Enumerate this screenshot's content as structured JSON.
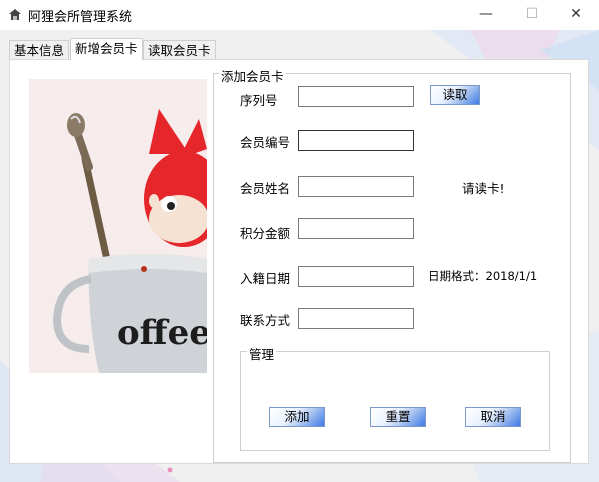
{
  "window": {
    "title": "阿狸会所管理系统",
    "minimize": "—",
    "maximize": "☐",
    "close": "✕"
  },
  "tabs": [
    {
      "label": "基本信息",
      "active": false
    },
    {
      "label": "新增会员卡",
      "active": true
    },
    {
      "label": "读取会员卡",
      "active": false
    }
  ],
  "image": {
    "text": "offee"
  },
  "form": {
    "group_title": "添加会员卡",
    "serial_label": "序列号",
    "serial_value": "",
    "read_button": "读取",
    "member_no_label": "会员编号",
    "member_no_value": "",
    "name_label": "会员姓名",
    "name_value": "",
    "name_hint": "请读卡!",
    "points_label": "积分金额",
    "points_value": "",
    "join_date_label": "入籍日期",
    "join_date_value": "",
    "date_hint": "日期格式：2018/1/1",
    "contact_label": "联系方式",
    "contact_value": ""
  },
  "manage": {
    "title": "管理",
    "add": "添加",
    "reset": "重置",
    "cancel": "取消"
  },
  "colors": {
    "button_accent": "#3d7ae6",
    "fox_red": "#e5262a"
  }
}
